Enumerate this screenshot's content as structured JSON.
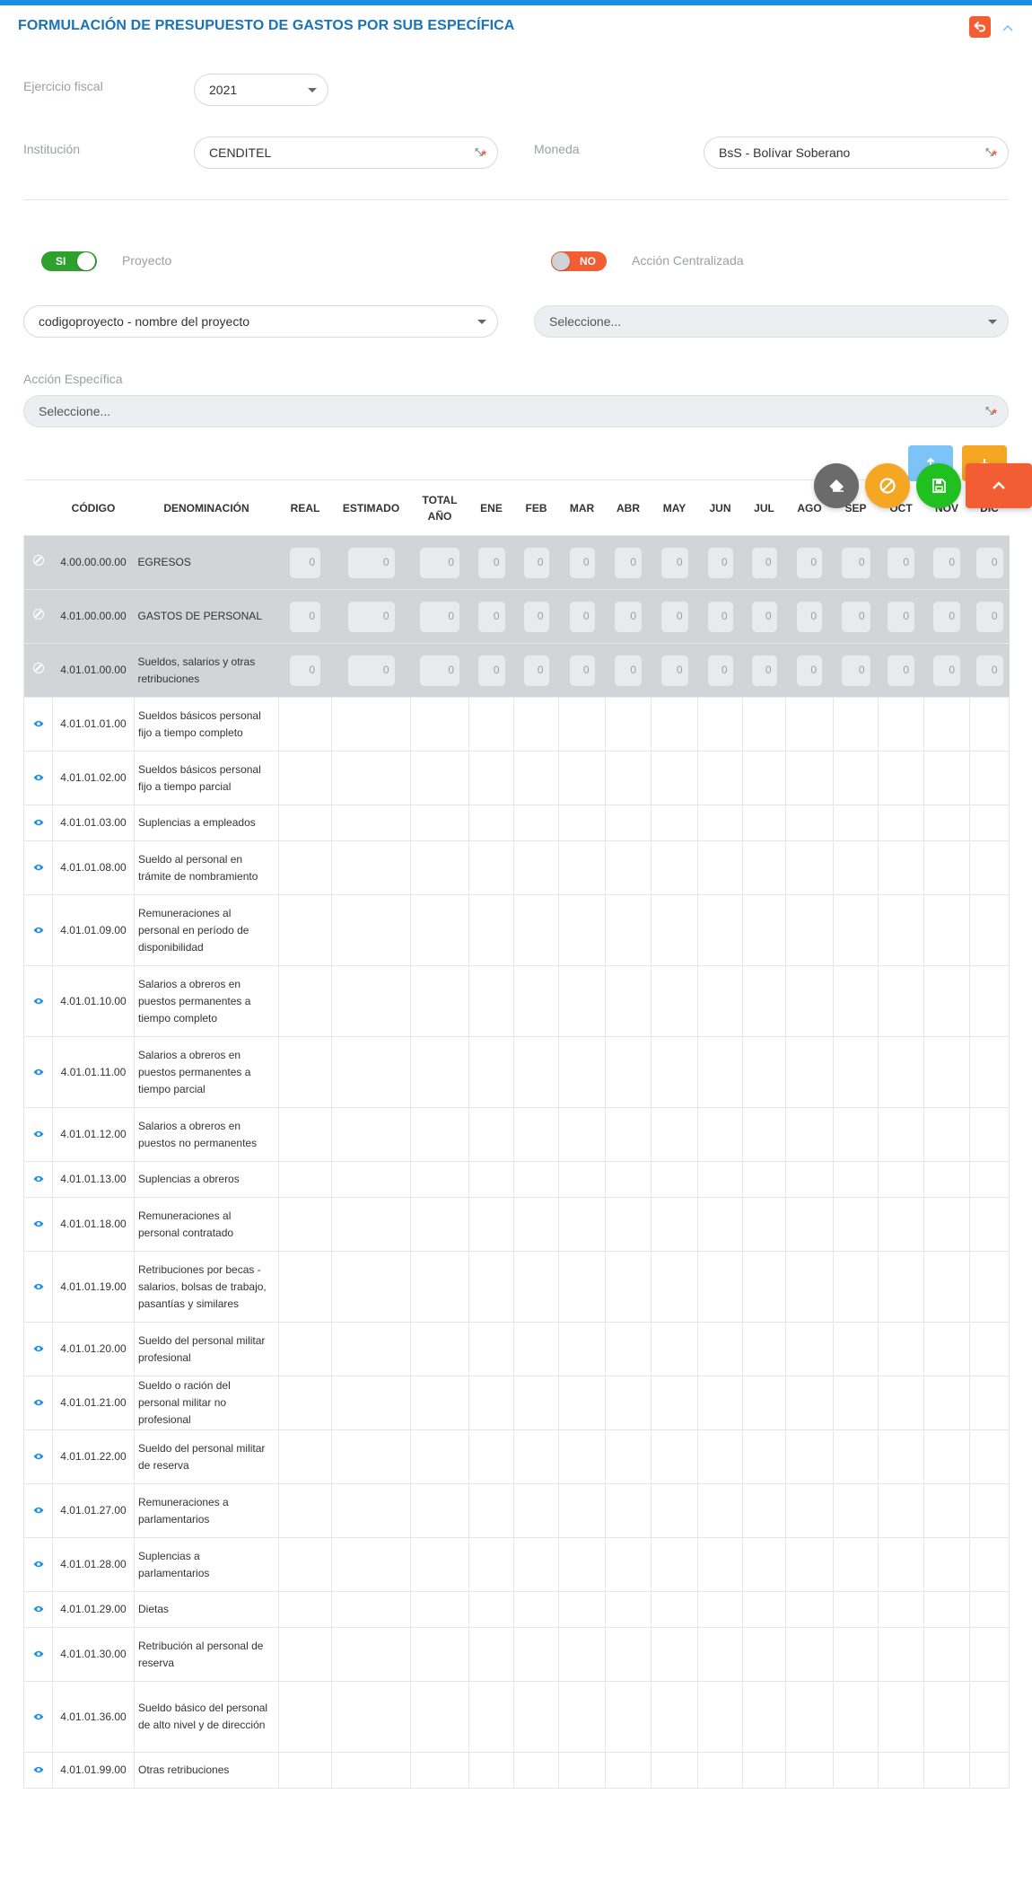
{
  "title": "FORMULACIÓN DE PRESUPUESTO DE GASTOS POR SUB ESPECÍFICA",
  "form": {
    "fiscal_year": {
      "label": "Ejercicio fiscal",
      "value": "2021"
    },
    "institution": {
      "label": "Institución",
      "value": "CENDITEL"
    },
    "currency": {
      "label": "Moneda",
      "value": "BsS - Bolívar Soberano"
    },
    "project_toggle": {
      "state": "SI",
      "label": "Proyecto"
    },
    "central_toggle": {
      "state": "NO",
      "label": "Acción Centralizada"
    },
    "project_select": {
      "value": "codigoproyecto - nombre del proyecto"
    },
    "central_select": {
      "value": "Seleccione..."
    },
    "specific_action": {
      "label": "Acción Específica",
      "value": "Seleccione..."
    }
  },
  "table": {
    "headers": [
      "CÓDIGO",
      "DENOMINACIÓN",
      "REAL",
      "ESTIMADO",
      "TOTAL AÑO",
      "ENE",
      "FEB",
      "MAR",
      "ABR",
      "MAY",
      "JUN",
      "JUL",
      "AGO",
      "SEP",
      "OCT",
      "NOV",
      "DIC"
    ],
    "group_rows": [
      {
        "code": "4.00.00.00.00",
        "name": "EGRESOS",
        "values": [
          "0",
          "0",
          "0",
          "0",
          "0",
          "0",
          "0",
          "0",
          "0",
          "0",
          "0",
          "0",
          "0",
          "0",
          "0"
        ]
      },
      {
        "code": "4.01.00.00.00",
        "name": "GASTOS DE PERSONAL",
        "values": [
          "0",
          "0",
          "0",
          "0",
          "0",
          "0",
          "0",
          "0",
          "0",
          "0",
          "0",
          "0",
          "0",
          "0",
          "0"
        ]
      },
      {
        "code": "4.01.01.00.00",
        "name": "Sueldos, salarios y otras retribuciones",
        "values": [
          "0",
          "0",
          "0",
          "0",
          "0",
          "0",
          "0",
          "0",
          "0",
          "0",
          "0",
          "0",
          "0",
          "0",
          "0"
        ]
      }
    ],
    "rows": [
      {
        "code": "4.01.01.01.00",
        "name": "Sueldos básicos personal fijo a tiempo completo"
      },
      {
        "code": "4.01.01.02.00",
        "name": "Sueldos básicos personal fijo a tiempo parcial"
      },
      {
        "code": "4.01.01.03.00",
        "name": "Suplencias a empleados"
      },
      {
        "code": "4.01.01.08.00",
        "name": "Sueldo al personal en trámite de nombramiento"
      },
      {
        "code": "4.01.01.09.00",
        "name": "Remuneraciones al personal en período de disponibilidad"
      },
      {
        "code": "4.01.01.10.00",
        "name": "Salarios a obreros en puestos permanentes a tiempo completo"
      },
      {
        "code": "4.01.01.11.00",
        "name": "Salarios a obreros en puestos permanentes a tiempo parcial"
      },
      {
        "code": "4.01.01.12.00",
        "name": "Salarios a obreros en puestos no permanentes"
      },
      {
        "code": "4.01.01.13.00",
        "name": "Suplencias a obreros"
      },
      {
        "code": "4.01.01.18.00",
        "name": "Remuneraciones al personal contratado"
      },
      {
        "code": "4.01.01.19.00",
        "name": "Retribuciones por becas - salarios, bolsas de trabajo, pasantías y similares"
      },
      {
        "code": "4.01.01.20.00",
        "name": "Sueldo del personal militar profesional"
      },
      {
        "code": "4.01.01.21.00",
        "name": "Sueldo o ración del personal militar no profesional"
      },
      {
        "code": "4.01.01.22.00",
        "name": "Sueldo del personal militar de reserva"
      },
      {
        "code": "4.01.01.27.00",
        "name": "Remuneraciones a parlamentarios"
      },
      {
        "code": "4.01.01.28.00",
        "name": "Suplencias a parlamentarios"
      },
      {
        "code": "4.01.01.29.00",
        "name": "Dietas"
      },
      {
        "code": "4.01.01.30.00",
        "name": "Retribución al personal de reserva"
      },
      {
        "code": "4.01.01.36.00",
        "name": "Sueldo básico del personal de alto nivel y de dirección"
      },
      {
        "code": "4.01.01.99.00",
        "name": "Otras retribuciones"
      }
    ]
  },
  "icons": {
    "back": "undo-icon",
    "collapse": "chevron-up-icon",
    "upload": "upload-icon",
    "download": "download-icon",
    "eraser": "eraser-icon",
    "cancel": "ban-icon",
    "save": "save-icon",
    "scroll_top": "chevron-up-icon",
    "row_view": "eye-icon",
    "row_disabled": "ban-icon"
  },
  "colors": {
    "accent": "#1a73b5",
    "danger": "#f35d33",
    "success": "#2ea02e",
    "warning": "#f5a623",
    "info": "#7cc4f8",
    "group_row": "#d2d4d7"
  }
}
